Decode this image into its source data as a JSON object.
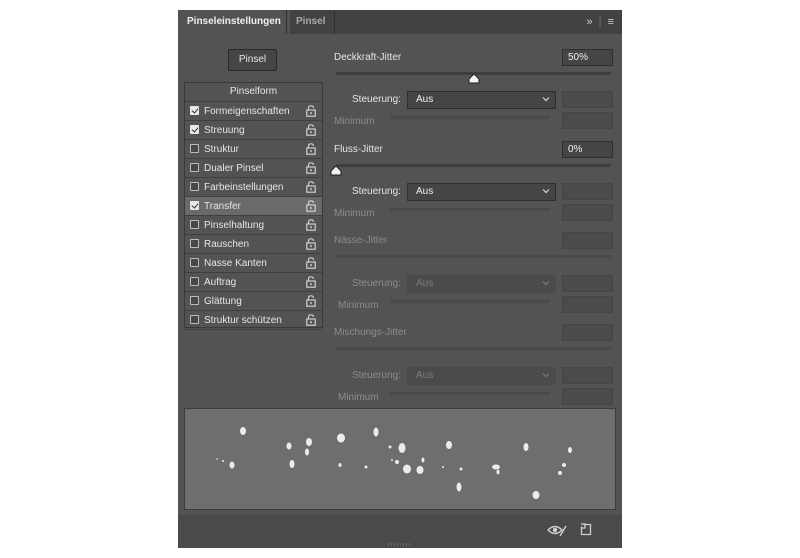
{
  "tabs": [
    {
      "label": "Pinseleinstellungen",
      "active": true
    },
    {
      "label": "Pinsel",
      "active": false
    }
  ],
  "header_icons": [
    "expand-icon",
    "menu-icon"
  ],
  "brush_button": "Pinsel",
  "sidebar": {
    "header": "Pinselform",
    "items": [
      {
        "label": "Formeigenschaften",
        "checked": true
      },
      {
        "label": "Streuung",
        "checked": true
      },
      {
        "label": "Struktur",
        "checked": false
      },
      {
        "label": "Dualer Pinsel",
        "checked": false
      },
      {
        "label": "Farbeinstellungen",
        "checked": false
      },
      {
        "label": "Transfer",
        "checked": true,
        "selected": true
      },
      {
        "label": "Pinselhaltung",
        "checked": false
      },
      {
        "label": "Rauschen",
        "checked": false
      },
      {
        "label": "Nasse Kanten",
        "checked": false
      },
      {
        "label": "Auftrag",
        "checked": false
      },
      {
        "label": "Glättung",
        "checked": false
      },
      {
        "label": "Struktur schützen",
        "checked": false
      }
    ]
  },
  "opacity": {
    "label": "Deckkraft-Jitter",
    "value": "50%",
    "slider_fraction": 0.5,
    "control_label": "Steuerung:",
    "control_value": "Aus",
    "minimum_label": "Minimum"
  },
  "flow": {
    "label": "Fluss-Jitter",
    "value": "0%",
    "slider_fraction": 0.0,
    "control_label": "Steuerung:",
    "control_value": "Aus",
    "minimum_label": "Minimum"
  },
  "wetness": {
    "label": "Nässe-Jitter",
    "control_label": "Steuerung:",
    "control_value": "Aus",
    "minimum_label": "Minimum"
  },
  "mix": {
    "label": "Mischungs-Jitter",
    "control_label": "Steuerung:",
    "control_value": "Aus",
    "minimum_label": "Minimum"
  },
  "footer_icons": [
    "eye-toggle-icon",
    "new-preset-icon"
  ],
  "colors": {
    "panel": "#535353",
    "tabbar": "#424242",
    "preview": "#6e6e6e",
    "selected_row": "#6a6a6a"
  }
}
